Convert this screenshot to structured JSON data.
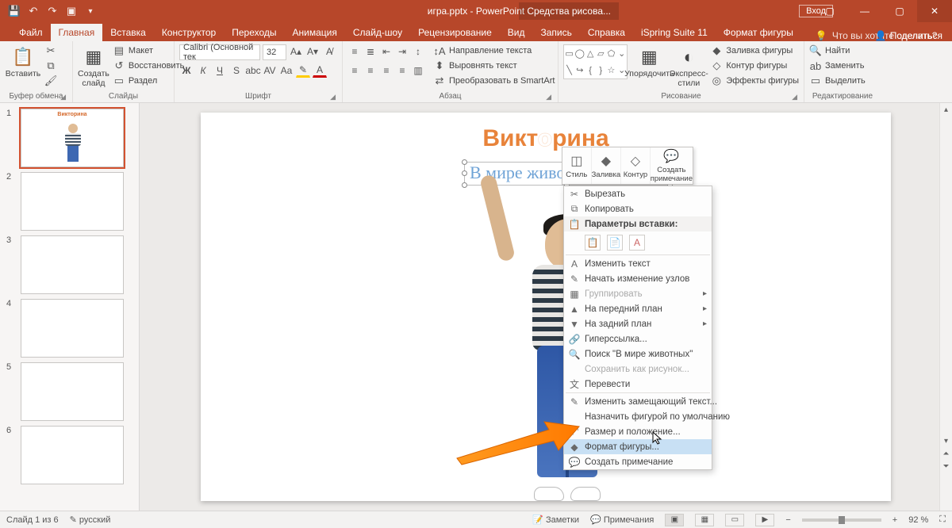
{
  "titlebar": {
    "filename": "игра.pptx - PowerPoint",
    "contextual_tab": "Средства рисова...",
    "login": "Вход",
    "share": "Поделиться"
  },
  "tabs": {
    "file": "Файл",
    "home": "Главная",
    "insert": "Вставка",
    "design": "Конструктор",
    "transitions": "Переходы",
    "animations": "Анимация",
    "slideshow": "Слайд-шоу",
    "review": "Рецензирование",
    "view": "Вид",
    "recording": "Запись",
    "help": "Справка",
    "ispring": "iSpring Suite 11",
    "format": "Формат фигуры",
    "tellme": "Что вы хотите сделать?"
  },
  "ribbon": {
    "clipboard": {
      "label": "Буфер обмена",
      "paste": "Вставить"
    },
    "slides": {
      "label": "Слайды",
      "new_slide": "Создать слайд",
      "layout": "Макет",
      "reset": "Восстановить",
      "section": "Раздел"
    },
    "font": {
      "label": "Шрифт",
      "name": "Calibri (Основной тек",
      "size": "32"
    },
    "paragraph": {
      "label": "Абзац",
      "direction": "Направление текста",
      "align": "Выровнять текст",
      "smartart": "Преобразовать в SmartArt"
    },
    "drawing": {
      "label": "Рисование",
      "arrange": "Упорядочить",
      "express": "Экспресс-стили",
      "fill": "Заливка фигуры",
      "outline": "Контур фигуры",
      "effects": "Эффекты фигуры"
    },
    "editing": {
      "label": "Редактирование",
      "find": "Найти",
      "replace": "Заменить",
      "select": "Выделить"
    }
  },
  "slide_content": {
    "title_chars": [
      "В",
      "и",
      "к",
      "т",
      "о",
      "р",
      "и",
      "н",
      "а"
    ],
    "subtitle": "В мире живо"
  },
  "mini_toolbar": {
    "style": "Стиль",
    "fill": "Заливка",
    "outline": "Контур",
    "comment": "Создать примечание"
  },
  "context_menu": {
    "cut": "Вырезать",
    "copy": "Копировать",
    "paste_title": "Параметры вставки:",
    "edit_text": "Изменить текст",
    "edit_points": "Начать изменение узлов",
    "group": "Группировать",
    "bring_front": "На передний план",
    "send_back": "На задний план",
    "hyperlink": "Гиперссылка...",
    "search": "Поиск \"В мире животных\"",
    "save_pic": "Сохранить как рисунок...",
    "translate": "Перевести",
    "alt_text": "Изменить замещающий текст...",
    "default_shape": "Назначить фигурой по умолчанию",
    "size_pos": "Размер и положение...",
    "format_shape": "Формат фигуры...",
    "new_comment": "Создать примечание"
  },
  "status": {
    "slide_of": "Слайд 1 из 6",
    "lang": "русский",
    "notes": "Заметки",
    "comments": "Примечания",
    "zoom": "92 %"
  },
  "thumbs": {
    "count": 6
  }
}
